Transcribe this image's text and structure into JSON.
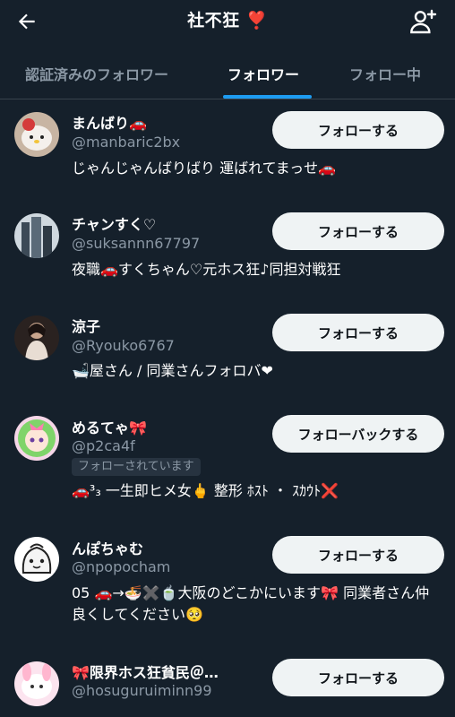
{
  "header": {
    "title": "社不狂 ❣️"
  },
  "tabs": [
    {
      "label": "認証済みのフォロワー",
      "active": false
    },
    {
      "label": "フォロワー",
      "active": true
    },
    {
      "label": "フォロー中",
      "active": false
    }
  ],
  "users": [
    {
      "name": "まんばり🚗",
      "handle": "@manbaric2bx",
      "bio": "じゃんじゃんばりばり 運ばれてまっせ🚗",
      "button": "フォローする"
    },
    {
      "name": "チャンすく♡",
      "handle": "@suksannn67797",
      "bio": "夜職🚗すくちゃん♡元ホス狂♪同担対戦狂",
      "button": "フォローする"
    },
    {
      "name": "涼子",
      "handle": "@Ryouko6767",
      "bio": "🛁屋さん / 同業さんフォロバ❤",
      "button": "フォローする"
    },
    {
      "name": "めるてゃ🎀",
      "handle": "@p2ca4f",
      "badge": "フォローされています",
      "bio": "🚗³₃ 一生即ヒメ女🖕 整形 ﾎｽﾄ ・ ｽｶｳﾄ❌",
      "button": "フォローバックする"
    },
    {
      "name": "んぽちゃむ",
      "handle": "@npopocham",
      "bio": "05 🚗→🍜✖️🍵大阪のどこかにいます🎀 同業者さん仲良くしてください🥺",
      "button": "フォローする"
    },
    {
      "name": "🎀限界ホス狂貧民＠…",
      "handle": "@hosuguruiminn99",
      "button": "フォローする"
    }
  ],
  "colors": {
    "background": "#15202b",
    "accent": "#1d9bf0",
    "secondary_text": "#8b98a5",
    "button_bg": "#eff3f4"
  }
}
